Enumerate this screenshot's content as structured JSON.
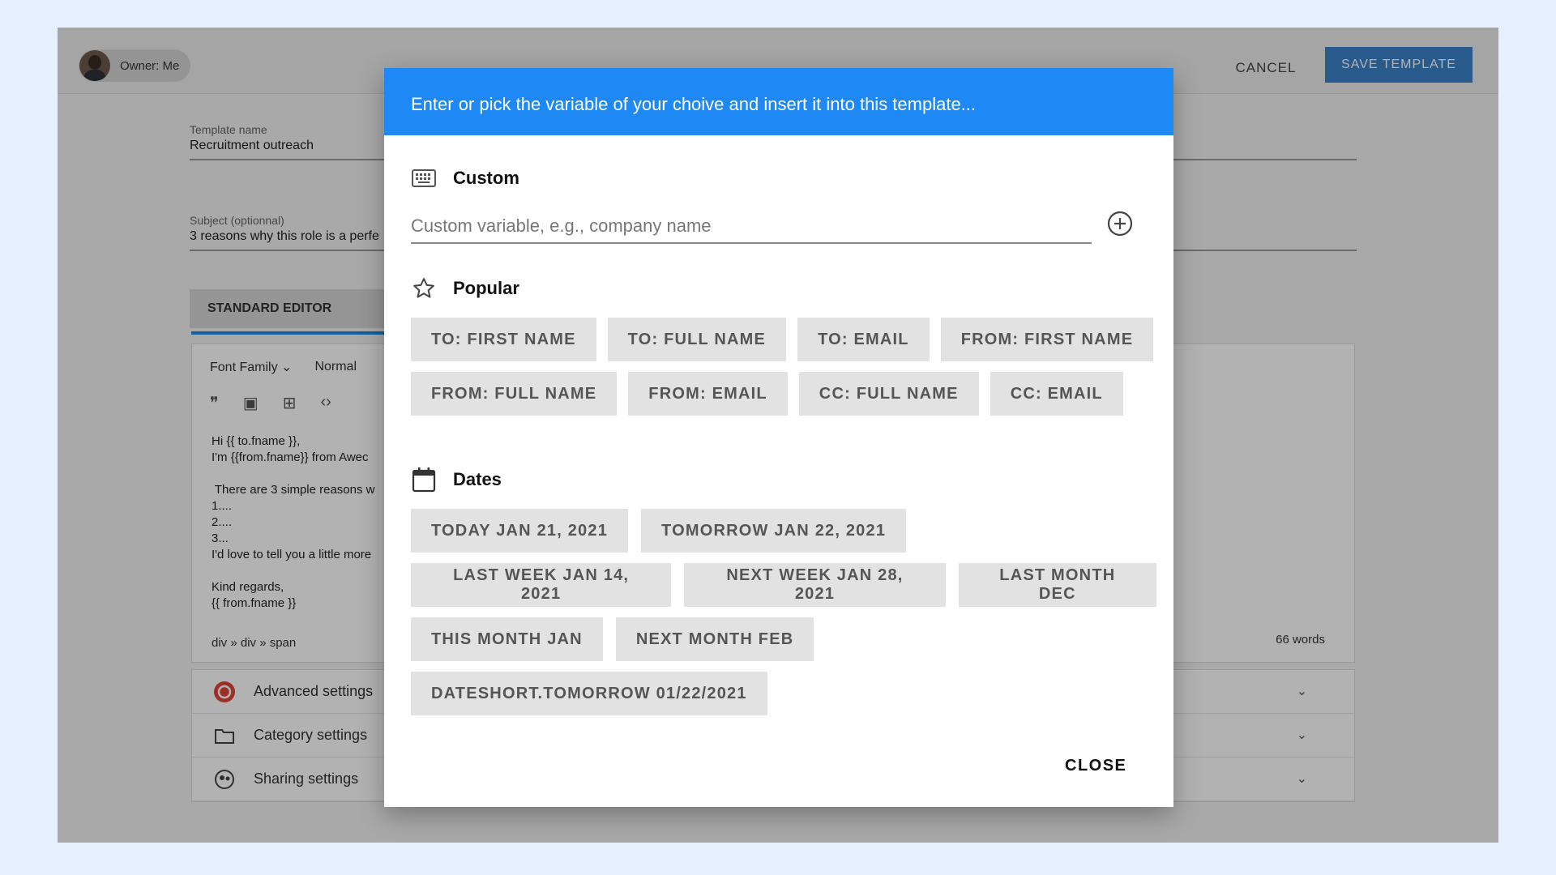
{
  "owner": {
    "label": "Owner: Me"
  },
  "header": {
    "cancel_label": "CANCEL",
    "save_label": "SAVE TEMPLATE"
  },
  "template_name": {
    "label": "Template name",
    "value": "Recruitment outreach"
  },
  "subject": {
    "label": "Subject (optionnal)",
    "value": "3 reasons why this role is a perfe"
  },
  "editor": {
    "tab_label": "STANDARD EDITOR",
    "font_family": "Font Family",
    "paragraph_style": "Normal",
    "body_lines": [
      "Hi {{ to.fname }},",
      "I'm {{from.fname}} from Awec",
      "",
      " There are 3 simple reasons w",
      "1....",
      "2....",
      "3...",
      "I'd love to tell you a little more",
      "",
      "Kind regards,",
      "{{ from.fname }}"
    ],
    "path": "div » div » span",
    "word_count": "66 words"
  },
  "settings": [
    {
      "label": "Advanced settings",
      "icon": "advanced-settings-icon"
    },
    {
      "label": "Category settings",
      "icon": "folder-icon"
    },
    {
      "label": "Sharing settings",
      "icon": "sharing-icon"
    }
  ],
  "dialog": {
    "title": "Enter or pick the variable of your choive and insert it into this template...",
    "custom": {
      "title": "Custom",
      "placeholder": "Custom variable, e.g., company name"
    },
    "popular": {
      "title": "Popular",
      "chips": [
        "TO: FIRST NAME",
        "TO: FULL NAME",
        "TO: EMAIL",
        "FROM: FIRST NAME",
        "FROM: FULL NAME",
        "FROM: EMAIL",
        "CC: FULL NAME",
        "CC: EMAIL"
      ]
    },
    "dates": {
      "title": "Dates",
      "chips": [
        "TODAY JAN 21, 2021",
        "TOMORROW JAN 22, 2021",
        "LAST WEEK JAN 14, 2021",
        "NEXT WEEK JAN 28, 2021",
        "LAST MONTH DEC",
        "THIS MONTH JAN",
        "NEXT MONTH FEB",
        "DATESHORT.TOMORROW 01/22/2021"
      ]
    },
    "close_label": "CLOSE"
  },
  "colors": {
    "dialog_header": "#1e88f5",
    "save_button": "#3b82c9",
    "chip_bg": "#e2e2e2",
    "scrim": "rgba(0,0,0,0.3)"
  }
}
